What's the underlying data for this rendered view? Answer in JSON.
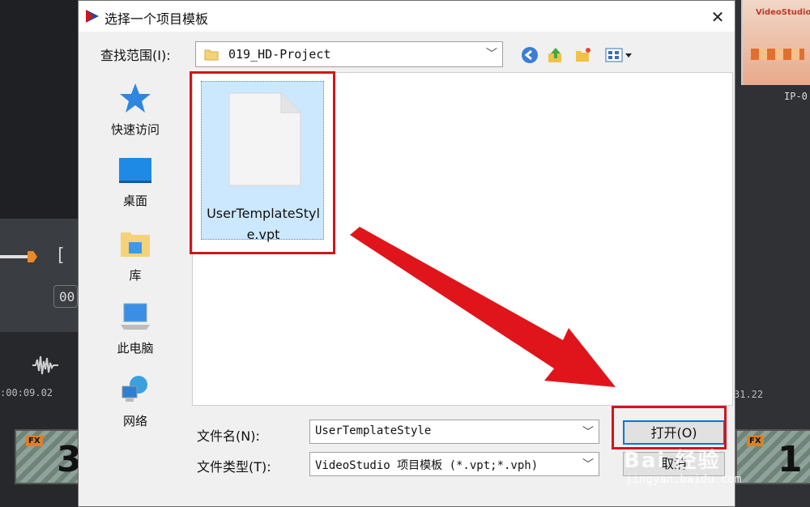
{
  "background": {
    "ruler_left": ":00:09.02",
    "ruler_right": "31.22",
    "clip_left_fx": "FX",
    "clip_left_num": "3",
    "clip_right_fx": "FX",
    "clip_right_num": "1",
    "thumb_title": "VideoStudio",
    "thumb_label": "IP-0",
    "timecode": "00",
    "bracket": "["
  },
  "dialog": {
    "title": "选择一个项目模板",
    "close": "✕",
    "lookin_label": "查找范围(I):",
    "lookin_value": "019_HD-Project",
    "places": [
      {
        "label": "快速访问",
        "icon": "star-icon"
      },
      {
        "label": "桌面",
        "icon": "desktop-icon"
      },
      {
        "label": "库",
        "icon": "library-icon"
      },
      {
        "label": "此电脑",
        "icon": "computer-icon"
      },
      {
        "label": "网络",
        "icon": "network-icon"
      }
    ],
    "file": {
      "name": "UserTemplateStyle.vpt",
      "name_line1": "UserTemplateStyl",
      "name_line2": "e.vpt"
    },
    "filename_label": "文件名(N):",
    "filename_value": "UserTemplateStyle",
    "filetype_label": "文件类型(T):",
    "filetype_value": "VideoStudio 项目模板 (*.vpt;*.vph)",
    "open_button": "打开(O)",
    "cancel_button": "取消"
  },
  "watermark": {
    "text": "Bai 经验",
    "url": "jingyan.baidu.com"
  },
  "colors": {
    "highlight": "#d0161c",
    "selection": "#cce8ff",
    "accent": "#0078d7"
  }
}
